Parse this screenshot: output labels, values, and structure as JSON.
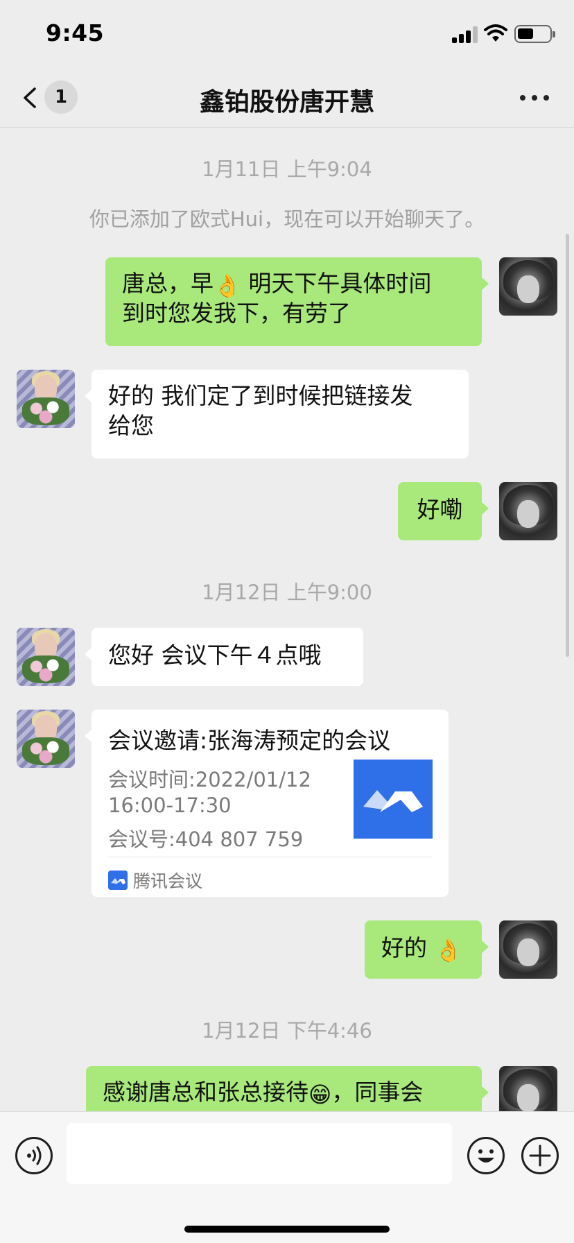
{
  "status_bar": {
    "time": "9:45"
  },
  "header": {
    "unread_count": "1",
    "title": "鑫铂股份唐开慧"
  },
  "chat": {
    "timestamp_1": "1月11日 上午9:04",
    "system_notice": "你已添加了欧式Hui，现在可以开始聊天了。",
    "msg_1_line_1_a": "唐总，早",
    "msg_1_line_1_emoji": "👌",
    "msg_1_line_1_b": " 明天下午具体时间",
    "msg_1_line_2": "到时您发我下，有劳了",
    "msg_2_line_1": "好的  我们定了到时候把链接发",
    "msg_2_line_2": "给您",
    "msg_3": "好嘞",
    "timestamp_2": "1月12日 上午9:00",
    "msg_4": "您好  会议下午４点哦",
    "meeting_card": {
      "title": "会议邀请:张海涛预定的会议",
      "line_1": "会议时间:2022/01/12",
      "line_2": "16:00-17:30",
      "line_3": "会议号:404 807 759",
      "source": "腾讯会议"
    },
    "msg_5_text": "好的",
    "msg_5_emoji": "👌",
    "timestamp_3": "1月12日 下午4:46",
    "msg_6_a": "感谢唐总和张总接待",
    "msg_6_emoji": "😁",
    "msg_6_b": "，同事会"
  },
  "icons": {
    "back": "chevron-left-icon",
    "more": "ellipsis-icon",
    "voice": "voice-icon",
    "emoji": "smile-icon",
    "plus": "plus-icon"
  },
  "colors": {
    "background": "#ededed",
    "my_bubble": "#a9e97c",
    "their_bubble": "#ffffff",
    "tencent_meeting_blue": "#2f6fe8"
  }
}
